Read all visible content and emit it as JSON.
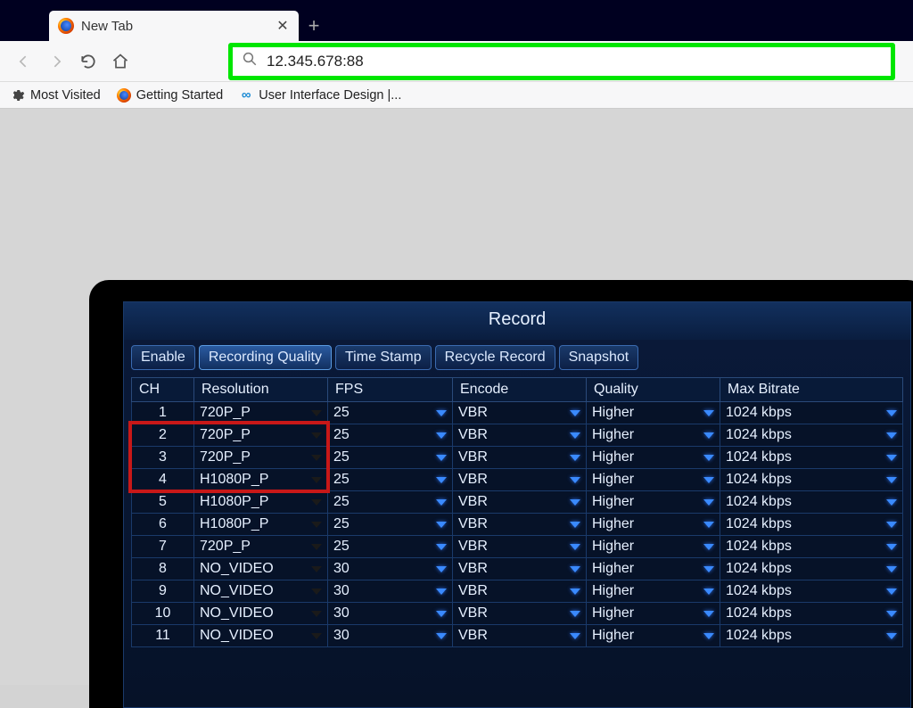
{
  "browser": {
    "tab_title": "New Tab",
    "url_value": "12.345.678:88",
    "bookmarks": {
      "most_visited": "Most Visited",
      "getting_started": "Getting Started",
      "ui_design": "User Interface Design |..."
    }
  },
  "dvr": {
    "title": "Record",
    "tabs": [
      "Enable",
      "Recording Quality",
      "Time Stamp",
      "Recycle Record",
      "Snapshot"
    ],
    "active_tab_index": 1,
    "columns": [
      "CH",
      "Resolution",
      "FPS",
      "Encode",
      "Quality",
      "Max Bitrate"
    ],
    "rows": [
      {
        "ch": "1",
        "res": "720P_P",
        "fps": "25",
        "enc": "VBR",
        "q": "Higher",
        "br": "1024 kbps"
      },
      {
        "ch": "2",
        "res": "720P_P",
        "fps": "25",
        "enc": "VBR",
        "q": "Higher",
        "br": "1024 kbps"
      },
      {
        "ch": "3",
        "res": "720P_P",
        "fps": "25",
        "enc": "VBR",
        "q": "Higher",
        "br": "1024 kbps"
      },
      {
        "ch": "4",
        "res": "H1080P_P",
        "fps": "25",
        "enc": "VBR",
        "q": "Higher",
        "br": "1024 kbps"
      },
      {
        "ch": "5",
        "res": "H1080P_P",
        "fps": "25",
        "enc": "VBR",
        "q": "Higher",
        "br": "1024 kbps"
      },
      {
        "ch": "6",
        "res": "H1080P_P",
        "fps": "25",
        "enc": "VBR",
        "q": "Higher",
        "br": "1024 kbps"
      },
      {
        "ch": "7",
        "res": "720P_P",
        "fps": "25",
        "enc": "VBR",
        "q": "Higher",
        "br": "1024 kbps"
      },
      {
        "ch": "8",
        "res": "NO_VIDEO",
        "fps": "30",
        "enc": "VBR",
        "q": "Higher",
        "br": "1024 kbps"
      },
      {
        "ch": "9",
        "res": "NO_VIDEO",
        "fps": "30",
        "enc": "VBR",
        "q": "Higher",
        "br": "1024 kbps"
      },
      {
        "ch": "10",
        "res": "NO_VIDEO",
        "fps": "30",
        "enc": "VBR",
        "q": "Higher",
        "br": "1024 kbps"
      },
      {
        "ch": "11",
        "res": "NO_VIDEO",
        "fps": "30",
        "enc": "VBR",
        "q": "Higher",
        "br": "1024 kbps"
      }
    ]
  },
  "annotations": {
    "red_highlight_rows": [
      1,
      2,
      3
    ]
  }
}
